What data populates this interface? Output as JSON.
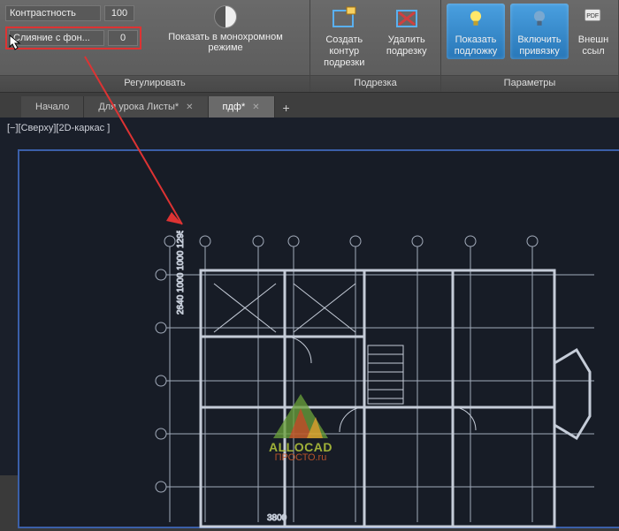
{
  "ribbon": {
    "regulate": {
      "title": "Регулировать",
      "contrast_label": "Контрастность",
      "contrast_value": "100",
      "fade_label": "Слияние с фон...",
      "fade_value": "0",
      "mono_label": "Показать в монохромном режиме"
    },
    "clip": {
      "title": "Подрезка",
      "create_label": "Создать контур подрезки",
      "remove_label": "Удалить подрезку"
    },
    "params": {
      "title": "Параметры",
      "show_underlay": "Показать подложку",
      "enable_snap": "Включить привязку",
      "external_refs": "Внешн ссыл"
    }
  },
  "tabs": {
    "t0": "Начало",
    "t1": "Для урока Листы*",
    "t2": "пдф*"
  },
  "viewport": {
    "label": "[−][Сверху][2D-каркас ]"
  },
  "watermark": {
    "line1": "ALLOCAD",
    "line2": "ПРОСТО.ru"
  }
}
